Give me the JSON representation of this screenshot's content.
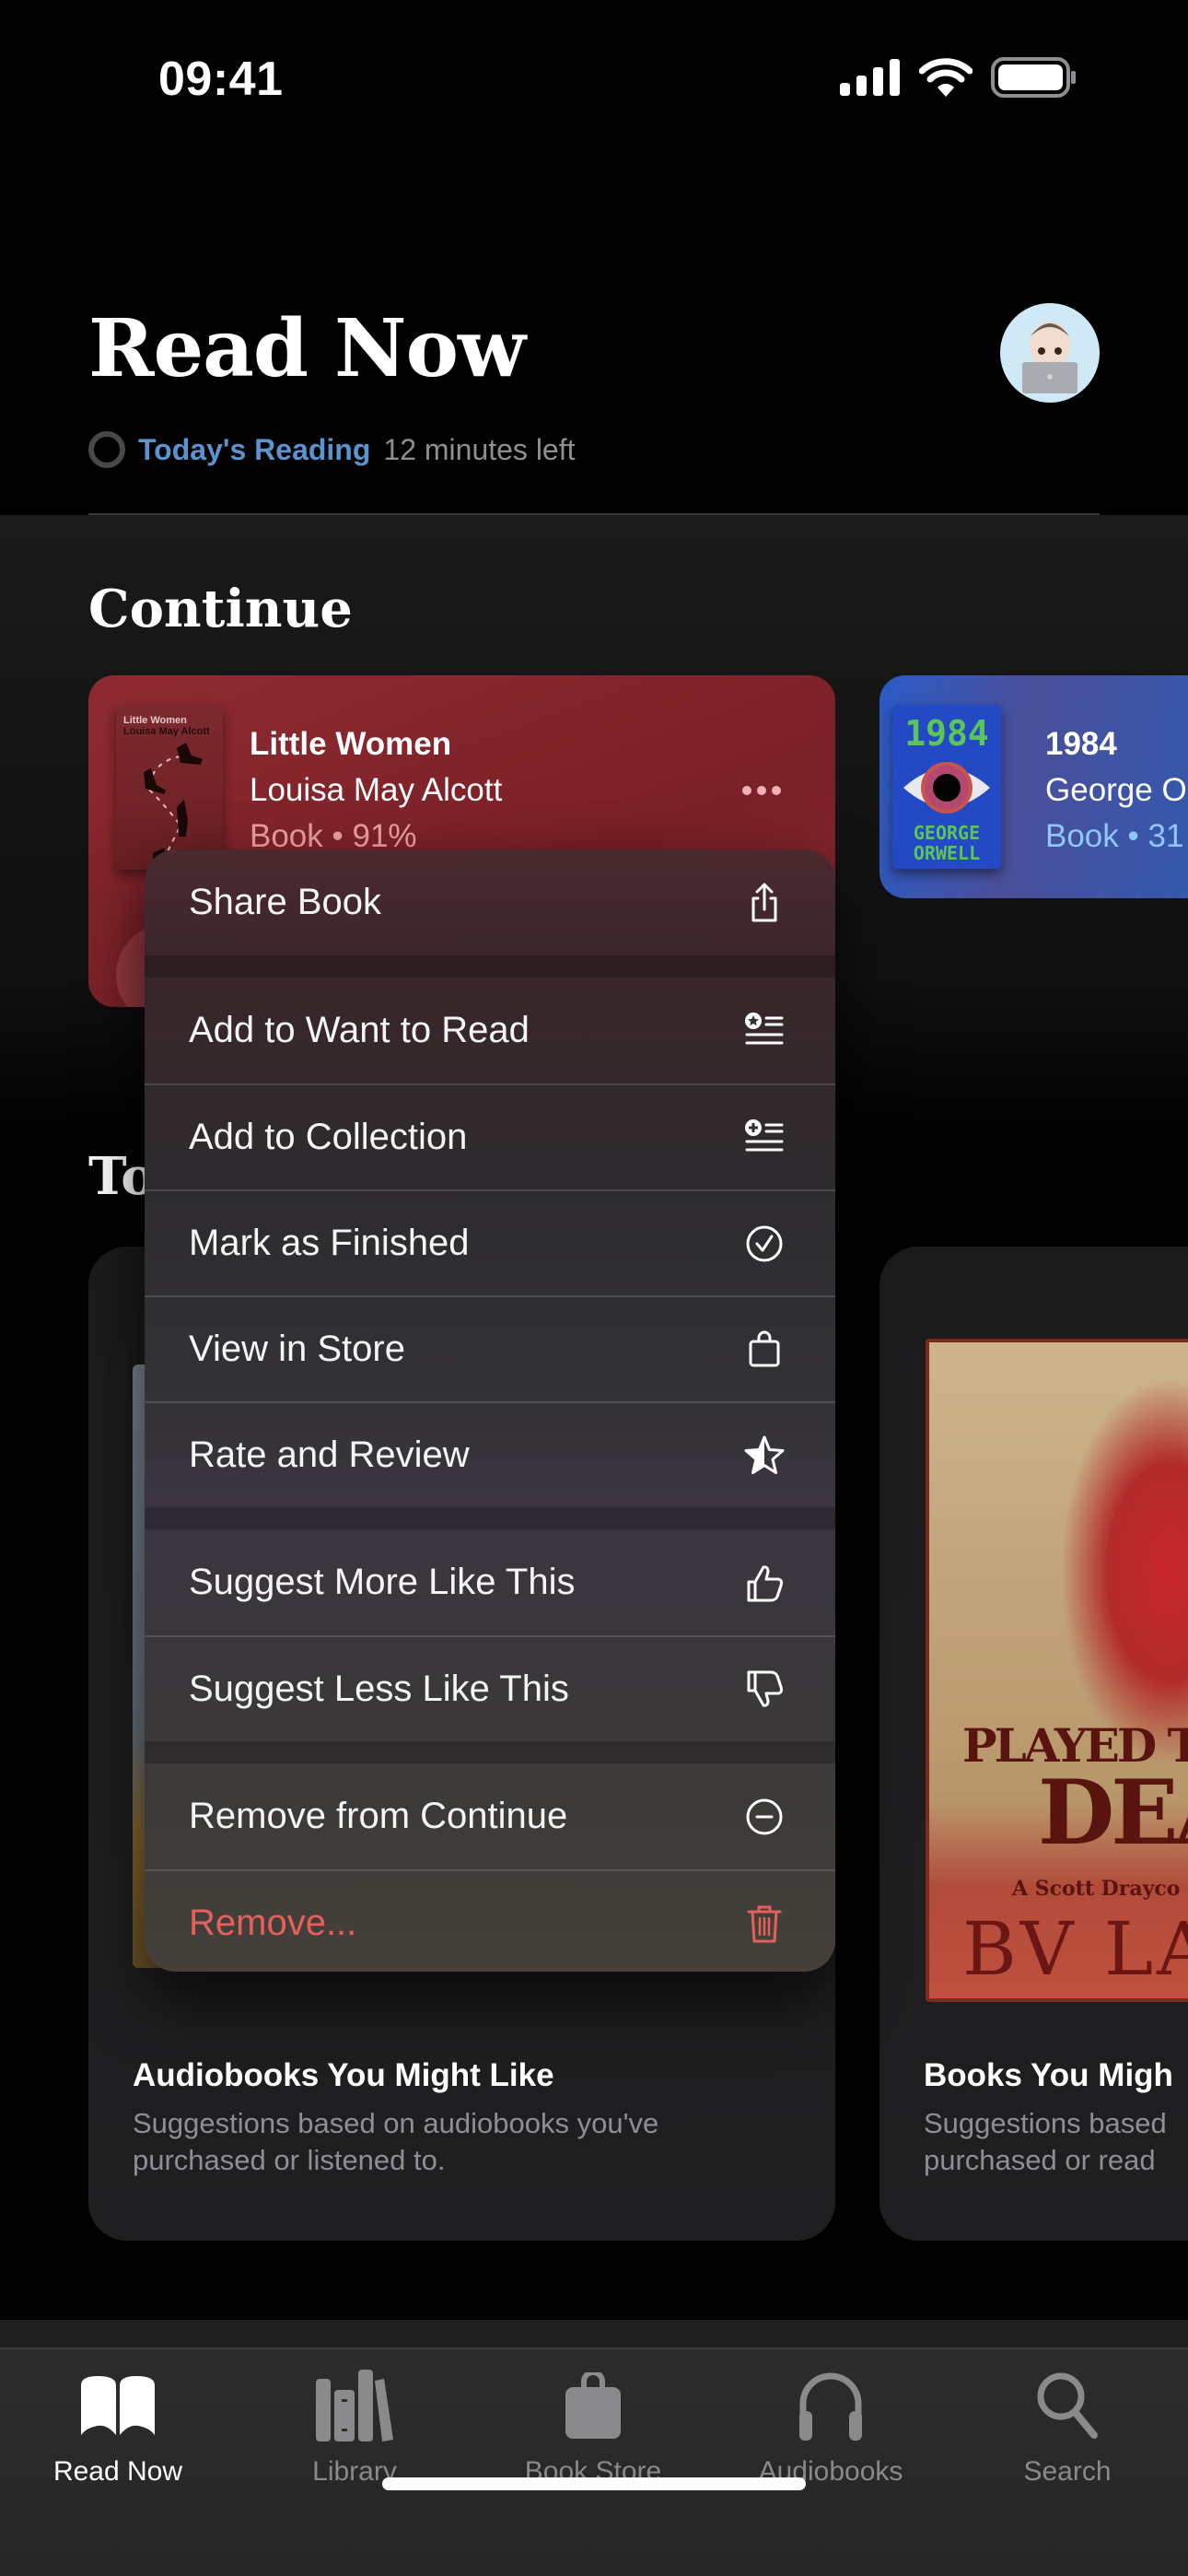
{
  "status_bar": {
    "time": "09:41",
    "icons": [
      "cellular-signal-icon",
      "wifi-icon",
      "battery-icon"
    ]
  },
  "header": {
    "title": "Read Now",
    "avatar": "memoji-avatar",
    "reading_goal": {
      "link": "Today's Reading",
      "remaining": "12 minutes left"
    }
  },
  "continue_section": {
    "title": "Continue",
    "books": [
      {
        "title": "Little Women",
        "author": "Louisa May Alcott",
        "meta": "Book • 91%",
        "cover_title": "Little Women",
        "cover_author": "Louisa May Alcott",
        "color": "#8b2a30"
      },
      {
        "title": "1984",
        "author": "George O",
        "meta": "Book • 31",
        "cover_title": "1984",
        "cover_author_1": "GEORGE",
        "cover_author_2": "ORWELL",
        "color": "#2a5bc6"
      }
    ]
  },
  "top_section": {
    "title_visible": "To"
  },
  "recommendations": [
    {
      "title": "Audiobooks You Might Like",
      "subtitle": "Suggestions based on audiobooks you've purchased or listened to."
    },
    {
      "title": "Books You Migh",
      "subtitle": "Suggestions based purchased or read",
      "cover": {
        "line1": "PLAYED TO",
        "line2": "DEA",
        "series": "A Scott Drayco",
        "author": "BV LAW"
      }
    }
  ],
  "context_menu": {
    "groups": [
      [
        {
          "label": "Share Book",
          "icon": "share-icon"
        }
      ],
      [
        {
          "label": "Add to Want to Read",
          "icon": "want-to-read-icon"
        },
        {
          "label": "Add to Collection",
          "icon": "add-to-collection-icon"
        },
        {
          "label": "Mark as Finished",
          "icon": "checkmark-circle-icon"
        },
        {
          "label": "View in Store",
          "icon": "shopping-bag-icon"
        },
        {
          "label": "Rate and Review",
          "icon": "star-icon"
        }
      ],
      [
        {
          "label": "Suggest More Like This",
          "icon": "thumbs-up-icon"
        },
        {
          "label": "Suggest Less Like This",
          "icon": "thumbs-down-icon"
        }
      ],
      [
        {
          "label": "Remove from Continue",
          "icon": "minus-circle-icon"
        },
        {
          "label": "Remove...",
          "icon": "trash-icon",
          "destructive": true
        }
      ]
    ],
    "destructive_color": "#e5605a"
  },
  "tab_bar": {
    "active_index": 0,
    "tabs": [
      {
        "label": "Read Now",
        "icon": "open-book-icon"
      },
      {
        "label": "Library",
        "icon": "library-books-icon"
      },
      {
        "label": "Book Store",
        "icon": "shopping-bag-icon"
      },
      {
        "label": "Audiobooks",
        "icon": "headphones-icon"
      },
      {
        "label": "Search",
        "icon": "magnifying-glass-icon"
      }
    ]
  },
  "colors": {
    "accent_link": "#5b93cf",
    "secondary_text": "#8e8e93",
    "tab_inactive": "#8a8a8c"
  }
}
